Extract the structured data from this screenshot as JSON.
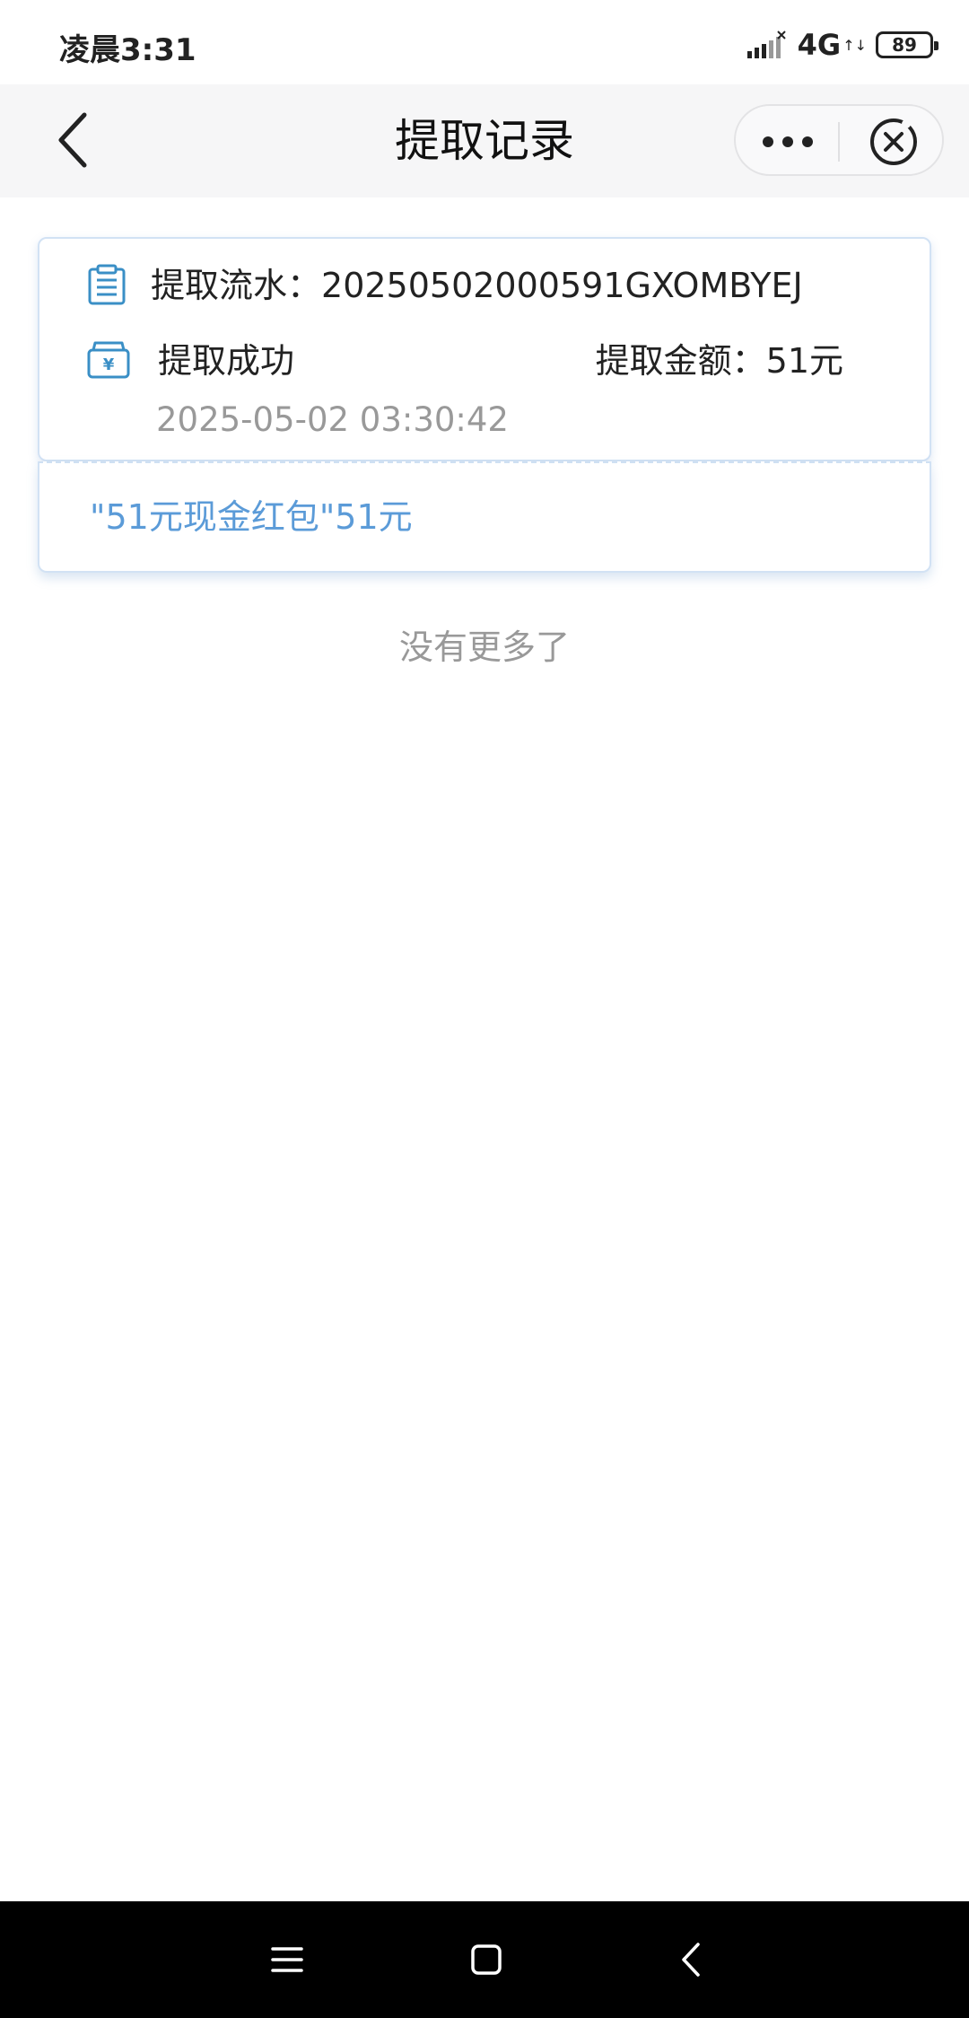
{
  "status_bar": {
    "time": "凌晨3:31",
    "network": "4G",
    "network_arrows": "↑↓",
    "battery": "89",
    "icons": [
      "signal-icon",
      "battery-icon"
    ]
  },
  "nav": {
    "title": "提取记录",
    "icons": [
      "back-icon",
      "more-icon",
      "close-icon"
    ]
  },
  "record": {
    "serial_label": "提取流水：",
    "serial_value": "20250502000591GXOMBYEJ",
    "status": "提取成功",
    "amount_label": "提取金额：",
    "amount_value": "51元",
    "time": "2025-05-02 03:30:42",
    "icons": [
      "document-icon",
      "wallet-icon"
    ],
    "accent_color": "#3a8fc6"
  },
  "detail": {
    "text": "\"51元现金红包\"51元",
    "color": "#5b9bd8"
  },
  "footer": {
    "no_more": "没有更多了"
  },
  "system_nav": {
    "icons": [
      "menu-icon",
      "home-icon",
      "back-icon"
    ]
  }
}
